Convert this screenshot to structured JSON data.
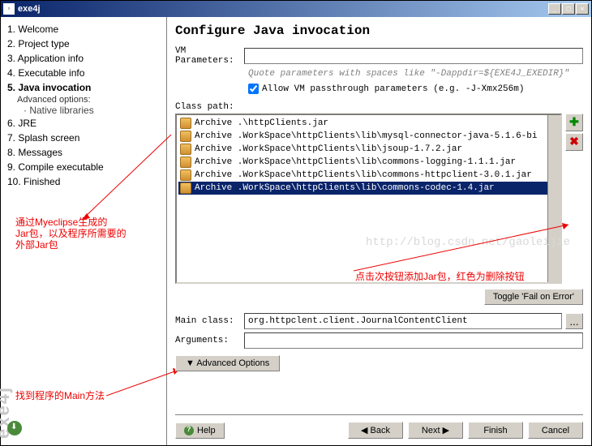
{
  "window": {
    "title": "exe4j"
  },
  "sidebar": {
    "items": [
      {
        "num": "1.",
        "label": "Welcome"
      },
      {
        "num": "2.",
        "label": "Project type"
      },
      {
        "num": "3.",
        "label": "Application info"
      },
      {
        "num": "4.",
        "label": "Executable info"
      },
      {
        "num": "5.",
        "label": "Java invocation",
        "current": true
      },
      {
        "num": "6.",
        "label": "JRE"
      },
      {
        "num": "7.",
        "label": "Splash screen"
      },
      {
        "num": "8.",
        "label": "Messages"
      },
      {
        "num": "9.",
        "label": "Compile executable"
      },
      {
        "num": "10.",
        "label": "Finished"
      }
    ],
    "adv_label": "Advanced options:",
    "adv_item": "· Native libraries"
  },
  "main": {
    "title": "Configure Java invocation",
    "vm_label": "VM Parameters:",
    "vm_value": "",
    "vm_hint": "Quote parameters with spaces like \"-Dappdir=${EXE4J_EXEDIR}\"",
    "allow_label": "Allow VM passthrough parameters (e.g. -J-Xmx256m)",
    "allow_checked": true,
    "classpath_label": "Class path:",
    "classpath": [
      "Archive .\\httpClients.jar",
      "Archive .WorkSpace\\httpClients\\lib\\mysql-connector-java-5.1.6-bi",
      "Archive .WorkSpace\\httpClients\\lib\\jsoup-1.7.2.jar",
      "Archive .WorkSpace\\httpClients\\lib\\commons-logging-1.1.1.jar",
      "Archive .WorkSpace\\httpClients\\lib\\commons-httpclient-3.0.1.jar",
      "Archive .WorkSpace\\httpClients\\lib\\commons-codec-1.4.jar"
    ],
    "classpath_selected": 5,
    "toggle_btn": "Toggle 'Fail on Error'",
    "mainclass_label": "Main class:",
    "mainclass_value": "org.httpclent.client.JournalContentClient",
    "mainclass_btn": "...",
    "args_label": "Arguments:",
    "args_value": "",
    "advopts_btn": "▼  Advanced Options",
    "help_btn": "Help",
    "back_btn": "◀  Back",
    "next_btn": "Next  ▶",
    "finish_btn": "Finish",
    "cancel_btn": "Cancel"
  },
  "annotations": {
    "a1_l1": "通过Myeclipse生成的",
    "a1_l2": "Jar包，以及程序所需要的",
    "a1_l3": "外部Jar包",
    "a2": "点击次按钮添加Jar包，红色为删除按钮",
    "a3": "找到程序的Main方法"
  },
  "watermark": "http://blog.csdn.net/gaoleijie"
}
